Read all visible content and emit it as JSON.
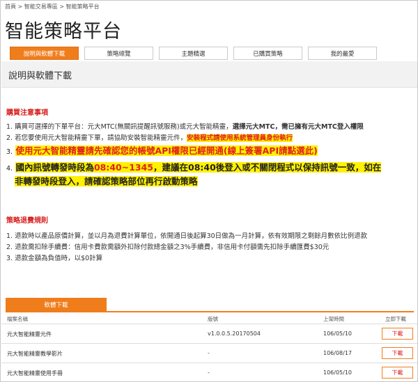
{
  "breadcrumb": "首頁 > 智能交易專區 > 智能策略平台",
  "page_title": "智能策略平台",
  "tabs": [
    {
      "label": "說明與軟體下載",
      "active": true
    },
    {
      "label": "策略總覽",
      "active": false
    },
    {
      "label": "主題精選",
      "active": false
    },
    {
      "label": "已購買策略",
      "active": false
    },
    {
      "label": "我的最愛",
      "active": false
    }
  ],
  "section_title": "說明與軟體下載",
  "purchase_notice": {
    "heading": "購買注意事項",
    "item1_a": "1. 購買可選擇的下單平台：元大MTC(無關訊提醒訊號服務)或元大智能精靈，",
    "item1_b": "選擇元大MTC，需已擁有元大MTC登入權限",
    "item2_a": "2. 若您要使用元大智能精靈下單，請協助安裝智能精靈元件，",
    "item2_b": "安裝程式請使用系統管理員身份執行",
    "item3_num": "3.",
    "item3_text": "使用元大智能精靈請先確認您的帳號API權限已經開通(線上簽署API請點選此)",
    "item4_num": "4.",
    "item4_a": "國內訊號轉發時段為",
    "item4_b": "08:40~1345",
    "item4_c": "，建議在08:40後登入或不關閉程式以保持訊號一致，如在",
    "item4_d": "非轉發時段登入，請確認策略部位再行啟動策略"
  },
  "refund_policy": {
    "heading": "策略退費規則",
    "items": [
      "1. 退款時以產品原價計算，並以月為退費計算單位，依開通日後起算30日做為一月計算，依有效期限之剩餘月數依比例退款",
      "2. 退款需扣除手續費：信用卡費款需額外扣除付款總金額之3%手續費，非信用卡付額需先扣除手續匯費$30元",
      "3. 退款金額為負值時，以$0計算"
    ]
  },
  "download": {
    "tab_label": "軟體下載",
    "columns": {
      "name": "檔案名稱",
      "version": "版號",
      "date": "上架時間",
      "action": "立即下載"
    },
    "rows": [
      {
        "name": "元大智能精靈元件",
        "version": "v1.0.0.5.20170504",
        "date": "106/05/10",
        "button": "下載"
      },
      {
        "name": "元大智能精靈教學影片",
        "version": "-",
        "date": "106/08/17",
        "button": "下載"
      },
      {
        "name": "元大智能精靈使用手冊",
        "version": "-",
        "date": "106/05/10",
        "button": "下載"
      }
    ]
  },
  "colors": {
    "accent": "#f07d1c",
    "alert_red": "#e0201f",
    "highlight": "#fff100"
  }
}
